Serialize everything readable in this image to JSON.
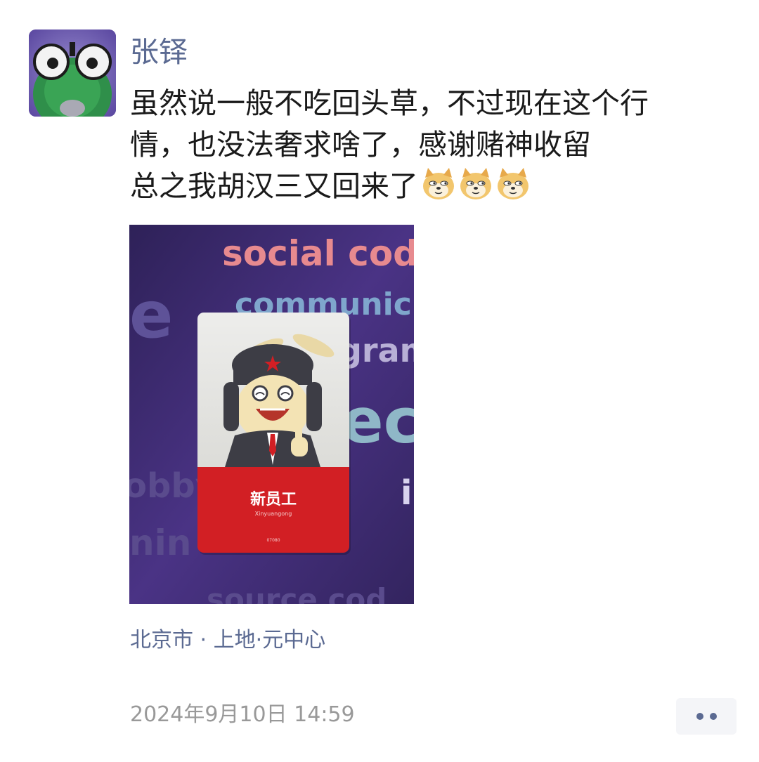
{
  "post": {
    "author": "张铎",
    "text_lines": [
      "虽然说一般不吃回头草，不过现在这个行",
      "情，也没法奢求啥了，感谢赌神收留",
      "总之我胡汉三又回来了"
    ],
    "emoji": [
      "doge-emoji",
      "doge-emoji",
      "doge-emoji"
    ],
    "photo": {
      "wall_text": [
        "social cod",
        "communic",
        "gram",
        "e",
        "ec",
        "obby",
        "nin",
        "source cod",
        "i"
      ],
      "card_title": "新员工",
      "card_subtitle": "Xinyuangong",
      "card_number": "07080"
    },
    "location": "北京市 · 上地·元中心",
    "timestamp": "2024年9月10日 14:59"
  },
  "colors": {
    "link_blue": "#5b6a92",
    "timestamp_gray": "#999999",
    "card_red": "#d21f24",
    "photo_purple": "#3d2b6c"
  }
}
